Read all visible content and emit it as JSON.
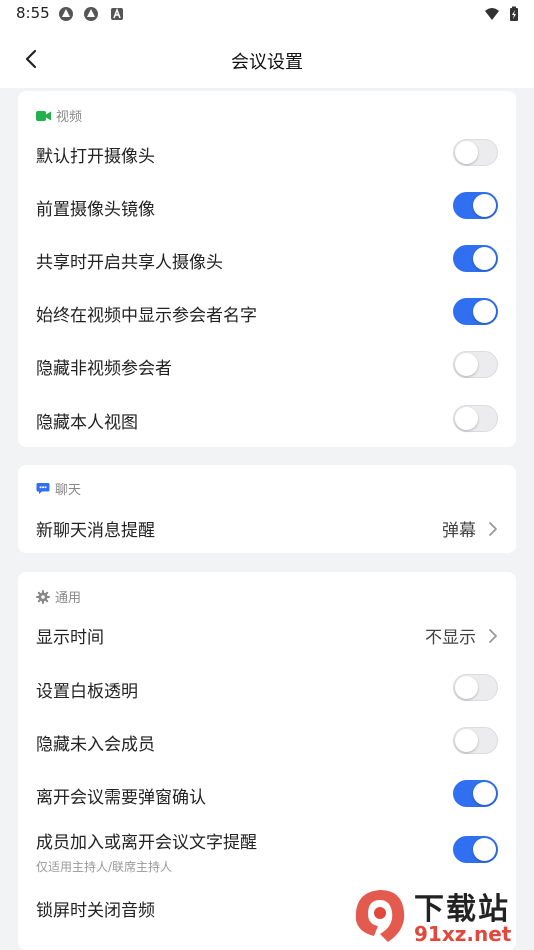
{
  "status_bar": {
    "time": "8:55"
  },
  "nav": {
    "title": "会议设置"
  },
  "video": {
    "title": "视频",
    "rows": [
      {
        "label": "默认打开摄像头",
        "on": false
      },
      {
        "label": "前置摄像头镜像",
        "on": true
      },
      {
        "label": "共享时开启共享人摄像头",
        "on": true
      },
      {
        "label": "始终在视频中显示参会者名字",
        "on": true
      },
      {
        "label": "隐藏非视频参会者",
        "on": false
      },
      {
        "label": "隐藏本人视图",
        "on": false
      }
    ]
  },
  "chat": {
    "title": "聊天",
    "new_msg": {
      "label": "新聊天消息提醒",
      "value": "弹幕"
    }
  },
  "general": {
    "title": "通用",
    "show_time": {
      "label": "显示时间",
      "value": "不显示"
    },
    "rows": [
      {
        "label": "设置白板透明",
        "on": false
      },
      {
        "label": "隐藏未入会成员",
        "on": false
      },
      {
        "label": "离开会议需要弹窗确认",
        "on": true
      },
      {
        "label": "成员加入或离开会议文字提醒",
        "sub": "仅适用主持人/联席主持人",
        "on": true
      },
      {
        "label": "锁屏时关闭音频"
      }
    ]
  },
  "watermark": {
    "line1": "下载站",
    "line2": "91xz.net"
  },
  "colors": {
    "accent": "#2f6ff0",
    "video_icon": "#23b14d",
    "chat_icon": "#2f6ff0",
    "background": "#f2f3f5"
  }
}
